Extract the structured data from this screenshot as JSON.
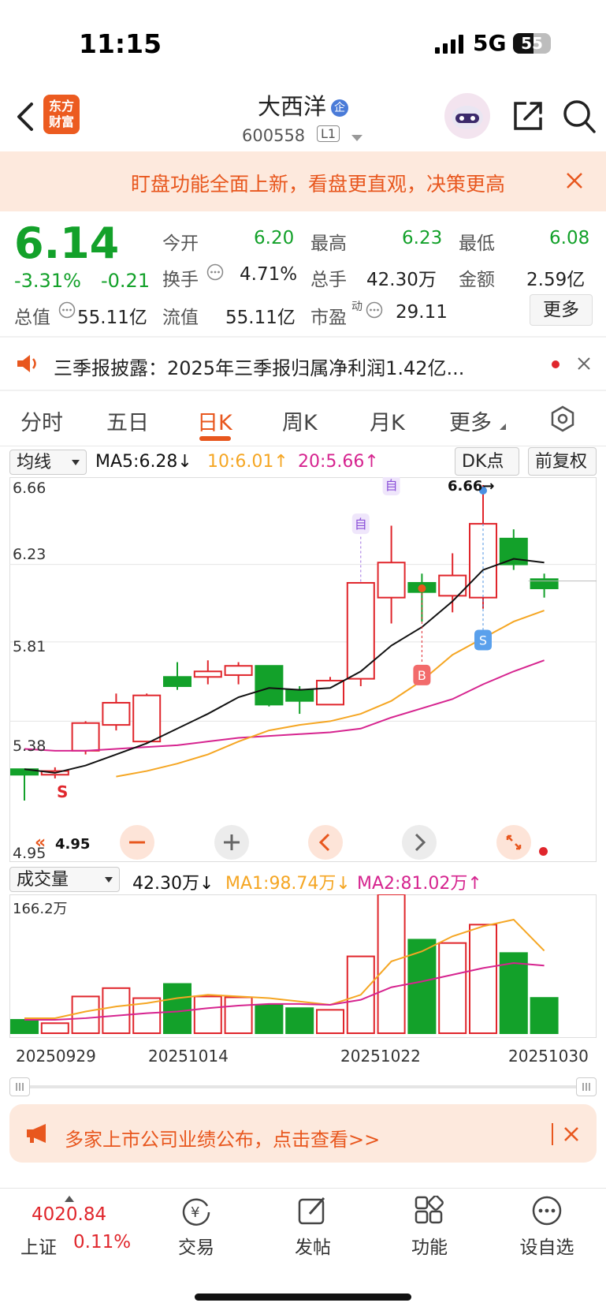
{
  "status": {
    "time": "11:15",
    "network": "5G",
    "battery": "55"
  },
  "header": {
    "name": "大西洋",
    "badge": "企",
    "code": "600558",
    "level": "L1"
  },
  "banner_top": {
    "text": "盯盘功能全面上新，看盘更直观，决策更高"
  },
  "quote": {
    "price": "6.14",
    "pct": "-3.31%",
    "change": "-0.21",
    "open_label": "今开",
    "open": "6.20",
    "high_label": "最高",
    "high": "6.23",
    "low_label": "最低",
    "low": "6.08",
    "turnover_label": "换手",
    "turnover": "4.71%",
    "vol_label": "总手",
    "vol": "42.30万",
    "amount_label": "金额",
    "amount": "2.59亿",
    "mcap_label": "总值",
    "mcap": "55.11亿",
    "float_label": "流值",
    "float": "55.11亿",
    "pe_label": "市盈",
    "pe_sup": "动",
    "pe": "29.11",
    "more": "更多"
  },
  "notice": {
    "text": "三季报披露：2025年三季报归属净利润1.42亿..."
  },
  "tabs": [
    "分时",
    "五日",
    "日K",
    "周K",
    "月K",
    "更多"
  ],
  "ma_bar": {
    "selector": "均线",
    "ma5": "MA5:6.28↓",
    "ma10": "10:6.01↑",
    "ma20": "20:5.66↑",
    "dk": "DK点",
    "fq": "前复权"
  },
  "price_axis": [
    "6.66",
    "6.23",
    "5.81",
    "5.38",
    "4.95"
  ],
  "annotations": {
    "max": "6.66→",
    "min": "4.95",
    "zi": "自",
    "b": "B",
    "s": "S"
  },
  "vol_bar": {
    "selector": "成交量",
    "vol": "42.30万↓",
    "ma1": "MA1:98.74万↓",
    "ma2": "MA2:81.02万↑",
    "max": "166.2万"
  },
  "dates": [
    "20250929",
    "20251014",
    "20251022",
    "20251030"
  ],
  "banner_bottom": {
    "text": "多家上市公司业绩公布，点击查看>>"
  },
  "bottom": {
    "index_value": "4020.84",
    "index_name": "上证",
    "index_pct": "0.11%",
    "items": [
      "交易",
      "发帖",
      "功能",
      "设自选"
    ]
  },
  "colors": {
    "up": "#e0262c",
    "down": "#13a12a",
    "accent": "#e8571e",
    "ma5": "#111111",
    "ma10": "#f5a623",
    "ma20": "#d6248f"
  },
  "chart_data": {
    "type": "candlestick",
    "x_range": [
      "20250929",
      "20251030"
    ],
    "ylim": [
      4.95,
      6.66
    ],
    "candles": [
      {
        "o": 5.12,
        "c": 5.09,
        "h": 5.12,
        "l": 4.95
      },
      {
        "o": 5.09,
        "c": 5.11,
        "h": 5.13,
        "l": 5.07
      },
      {
        "o": 5.22,
        "c": 5.37,
        "h": 5.38,
        "l": 5.2
      },
      {
        "o": 5.36,
        "c": 5.48,
        "h": 5.53,
        "l": 5.33
      },
      {
        "o": 5.27,
        "c": 5.52,
        "h": 5.53,
        "l": 5.26
      },
      {
        "o": 5.62,
        "c": 5.57,
        "h": 5.7,
        "l": 5.55
      },
      {
        "o": 5.62,
        "c": 5.65,
        "h": 5.71,
        "l": 5.58
      },
      {
        "o": 5.63,
        "c": 5.68,
        "h": 5.7,
        "l": 5.58
      },
      {
        "o": 5.68,
        "c": 5.47,
        "h": 5.68,
        "l": 5.46
      },
      {
        "o": 5.55,
        "c": 5.49,
        "h": 5.57,
        "l": 5.42
      },
      {
        "o": 5.47,
        "c": 5.6,
        "h": 5.62,
        "l": 5.47
      },
      {
        "o": 5.61,
        "c": 6.13,
        "h": 6.13,
        "l": 5.57
      },
      {
        "o": 6.05,
        "c": 6.24,
        "h": 6.44,
        "l": 5.91
      },
      {
        "o": 6.13,
        "c": 6.08,
        "h": 6.18,
        "l": 5.92
      },
      {
        "o": 6.06,
        "c": 6.17,
        "h": 6.29,
        "l": 5.97
      },
      {
        "o": 6.05,
        "c": 6.45,
        "h": 6.66,
        "l": 5.99
      },
      {
        "o": 6.37,
        "c": 6.23,
        "h": 6.42,
        "l": 6.2
      },
      {
        "o": 6.15,
        "c": 6.1,
        "h": 6.18,
        "l": 6.05
      }
    ],
    "ma5": [
      5.12,
      5.1,
      5.14,
      5.2,
      5.26,
      5.34,
      5.42,
      5.51,
      5.56,
      5.55,
      5.56,
      5.65,
      5.79,
      5.89,
      6.03,
      6.2,
      6.26,
      6.24
    ],
    "ma10": [
      null,
      null,
      null,
      5.08,
      5.11,
      5.15,
      5.2,
      5.27,
      5.33,
      5.36,
      5.38,
      5.42,
      5.49,
      5.6,
      5.74,
      5.83,
      5.92,
      5.98
    ],
    "ma20": [
      5.23,
      5.22,
      5.22,
      5.23,
      5.24,
      5.25,
      5.27,
      5.29,
      5.3,
      5.31,
      5.32,
      5.34,
      5.4,
      5.45,
      5.5,
      5.58,
      5.65,
      5.71
    ],
    "volumes": [
      16,
      12,
      44,
      54,
      42,
      59,
      44,
      43,
      34,
      30,
      28,
      92,
      166.2,
      112,
      108,
      130,
      96,
      42.3
    ],
    "vol_ma1": [
      18,
      18,
      26,
      32,
      36,
      42,
      46,
      44,
      42,
      38,
      34,
      46,
      86,
      98,
      116,
      128,
      136,
      98.74
    ],
    "vol_ma2": [
      16,
      16,
      18,
      21,
      24,
      26,
      30,
      33,
      35,
      35,
      34,
      40,
      55,
      62,
      70,
      78,
      84,
      81.02
    ]
  }
}
